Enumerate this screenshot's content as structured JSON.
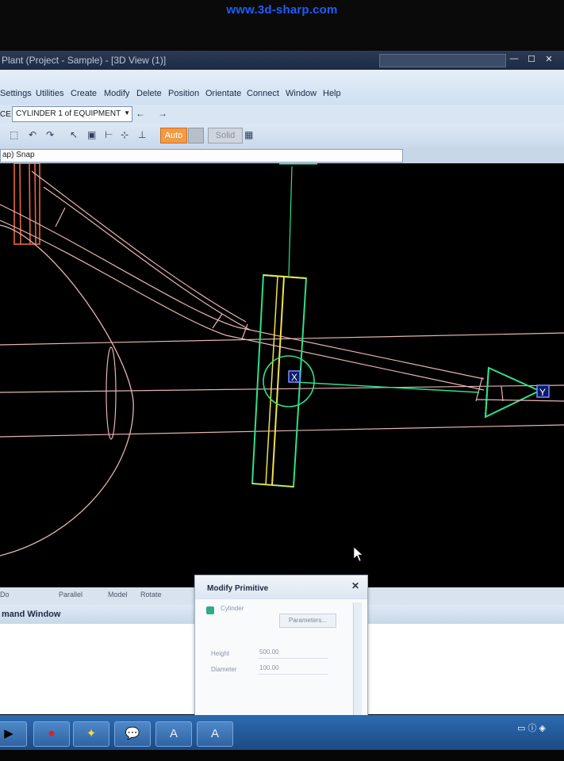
{
  "watermark": "www.3d-sharp.com",
  "window": {
    "title": "Plant (Project - Sample) - [3D View (1)]",
    "caption_field": "",
    "minimize_icon": "minimize-icon",
    "maximize_icon": "maximize-icon",
    "close_icon": "close-icon"
  },
  "menubar": {
    "items": [
      "Settings",
      "Utilities",
      "Create",
      "Modify",
      "Delete",
      "Position",
      "Orientate",
      "Connect",
      "Window",
      "Help"
    ]
  },
  "toolbar1": {
    "prefix": "CE",
    "element_select": "CYLINDER 1 of EQUIPMENT",
    "nav_back": "←",
    "nav_forward": "→"
  },
  "toolbar2": {
    "auto_label": "Auto",
    "solid_label": "Solid"
  },
  "snap": {
    "value": "ap) Snap"
  },
  "viewport": {
    "axis_x_label": "X",
    "axis_y_label": "Y",
    "colors": {
      "background": "#000000",
      "pipe": "#e7b4b4",
      "selected": "#2fe08a",
      "highlight": "#f2e24a",
      "equipment": "#e8663a",
      "handle": "#4466ff"
    }
  },
  "cmd_panel": {
    "tabs": [
      "Do",
      "Parallel",
      "Model",
      "Rotate"
    ],
    "title": "mand Window"
  },
  "modify_primitive": {
    "title": "Modify Primitive",
    "primitive": "Cylinder",
    "parameters_button": "Parameters...",
    "height_label": "Height",
    "height_value": "500.00",
    "diameter_label": "Diameter",
    "diameter_value": "100.00"
  },
  "taskbar": {
    "buttons": [
      "start-icon",
      "acrobat-icon",
      "app-icon",
      "chat-icon",
      "autocad-icon",
      "autocad-icon"
    ],
    "button_glyphs": [
      "▶",
      "⏺",
      "✦",
      "💬",
      "A",
      "A"
    ]
  }
}
